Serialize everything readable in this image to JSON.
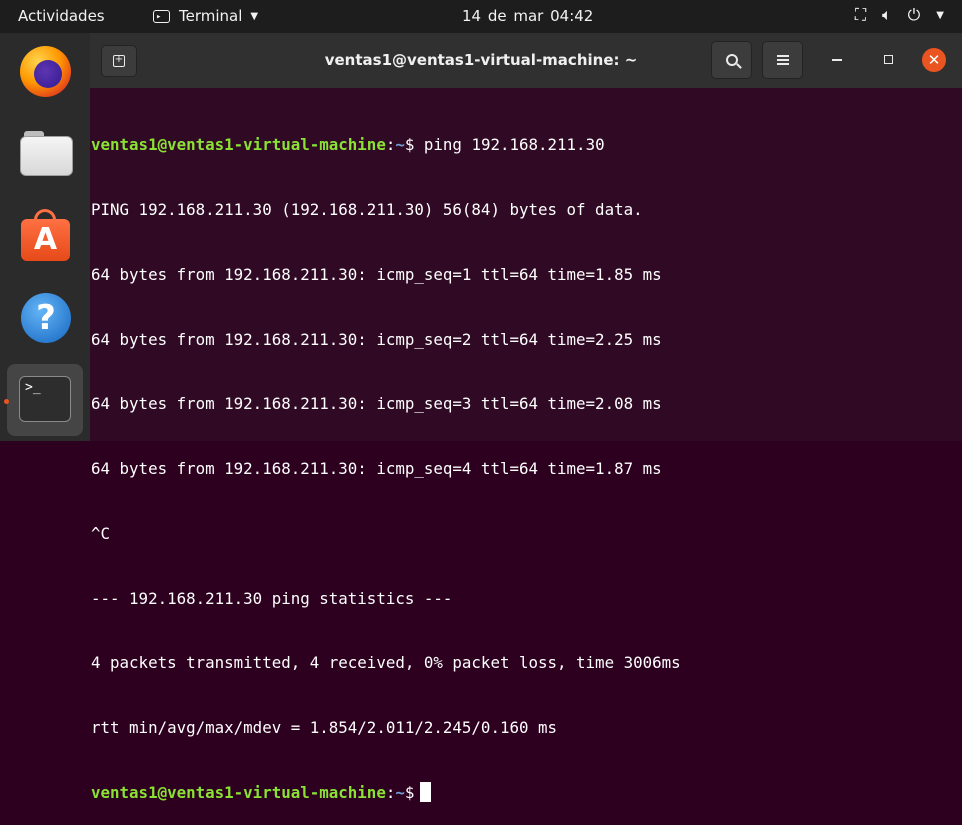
{
  "topbar": {
    "activities": "Actividades",
    "app_name": "Terminal",
    "clock": "14 de mar  04:42"
  },
  "window": {
    "title": "ventas1@ventas1-virtual-machine: ~"
  },
  "terminal": {
    "prompt_user": "ventas1@ventas1-virtual-machine",
    "prompt_path": "~",
    "prompt_symbol": "$",
    "command": " ping 192.168.211.30",
    "output": [
      "PING 192.168.211.30 (192.168.211.30) 56(84) bytes of data.",
      "64 bytes from 192.168.211.30: icmp_seq=1 ttl=64 time=1.85 ms",
      "64 bytes from 192.168.211.30: icmp_seq=2 ttl=64 time=2.25 ms",
      "64 bytes from 192.168.211.30: icmp_seq=3 ttl=64 time=2.08 ms",
      "64 bytes from 192.168.211.30: icmp_seq=4 ttl=64 time=1.87 ms",
      "^C",
      "--- 192.168.211.30 ping statistics ---",
      "4 packets transmitted, 4 received, 0% packet loss, time 3006ms",
      "rtt min/avg/max/mdev = 1.854/2.011/2.245/0.160 ms"
    ]
  },
  "dock": {
    "items": [
      "firefox-icon",
      "files-icon",
      "software-icon",
      "help-icon",
      "terminal-icon"
    ],
    "terminal_glyph": ">_"
  },
  "colors": {
    "terminal_bg": "#300a24",
    "prompt_user": "#8ae234",
    "prompt_path": "#729fcf",
    "accent": "#e95420"
  }
}
